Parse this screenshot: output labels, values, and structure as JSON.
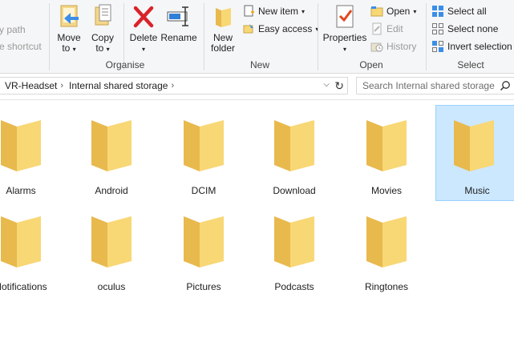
{
  "ribbon": {
    "clipboard_partial": {
      "copy_path": "y path",
      "paste_shortcut": "e shortcut"
    },
    "organise": {
      "move_to": "Move",
      "move_to_2": "to",
      "copy_to": "Copy",
      "copy_to_2": "to",
      "delete": "Delete",
      "rename": "Rename",
      "label": "Organise"
    },
    "new": {
      "new_folder": "New",
      "new_folder_2": "folder",
      "new_item": "New item",
      "easy_access": "Easy access",
      "label": "New"
    },
    "open": {
      "properties": "Properties",
      "open": "Open",
      "edit": "Edit",
      "history": "History",
      "label": "Open"
    },
    "select": {
      "select_all": "Select all",
      "select_none": "Select none",
      "invert_selection": "Invert selection",
      "label": "Select"
    }
  },
  "address": {
    "crumbs": [
      "VR-Headset",
      "Internal shared storage"
    ],
    "search_placeholder": "Search Internal shared storage"
  },
  "folders": [
    {
      "name": "Alarms",
      "selected": false
    },
    {
      "name": "Android",
      "selected": false
    },
    {
      "name": "DCIM",
      "selected": false
    },
    {
      "name": "Download",
      "selected": false
    },
    {
      "name": "Movies",
      "selected": false
    },
    {
      "name": "Music",
      "selected": true
    },
    {
      "name": "Notifications",
      "selected": false
    },
    {
      "name": "oculus",
      "selected": false
    },
    {
      "name": "Pictures",
      "selected": false
    },
    {
      "name": "Podcasts",
      "selected": false
    },
    {
      "name": "Ringtones",
      "selected": false
    }
  ],
  "colors": {
    "ribbon_bg": "#f5f6f7",
    "selection_bg": "#cce8ff",
    "selection_border": "#99d1ff",
    "folder_yellow": "#f8d775"
  }
}
